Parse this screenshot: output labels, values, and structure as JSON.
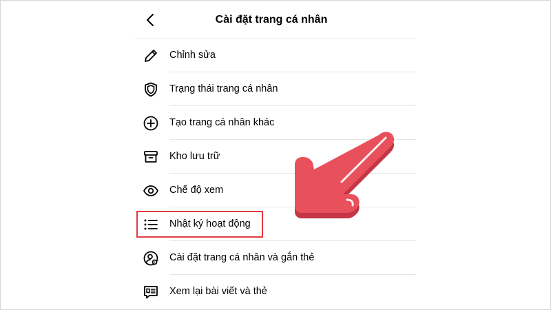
{
  "header": {
    "title": "Cài đặt trang cá nhân",
    "back_icon": "chevron-left-icon"
  },
  "items": [
    {
      "label": "Chỉnh sửa",
      "icon": "pencil-icon"
    },
    {
      "label": "Trạng thái trang cá nhân",
      "icon": "shield-icon"
    },
    {
      "label": "Tạo trang cá nhân khác",
      "icon": "plus-circle-icon"
    },
    {
      "label": "Kho lưu trữ",
      "icon": "archive-box-icon"
    },
    {
      "label": "Chế độ xem",
      "icon": "eye-icon"
    },
    {
      "label": "Nhật ký hoạt động",
      "icon": "list-icon",
      "highlighted": true
    },
    {
      "label": "Cài đặt trang cá nhân và gắn thẻ",
      "icon": "user-settings-icon"
    },
    {
      "label": "Xem lại bài viết và thẻ",
      "icon": "review-posts-icon"
    }
  ],
  "colors": {
    "highlight_border": "#e03a40",
    "arrow_fill": "#e8515c",
    "arrow_shadow": "#c23645",
    "separator": "#e6e6e6"
  }
}
